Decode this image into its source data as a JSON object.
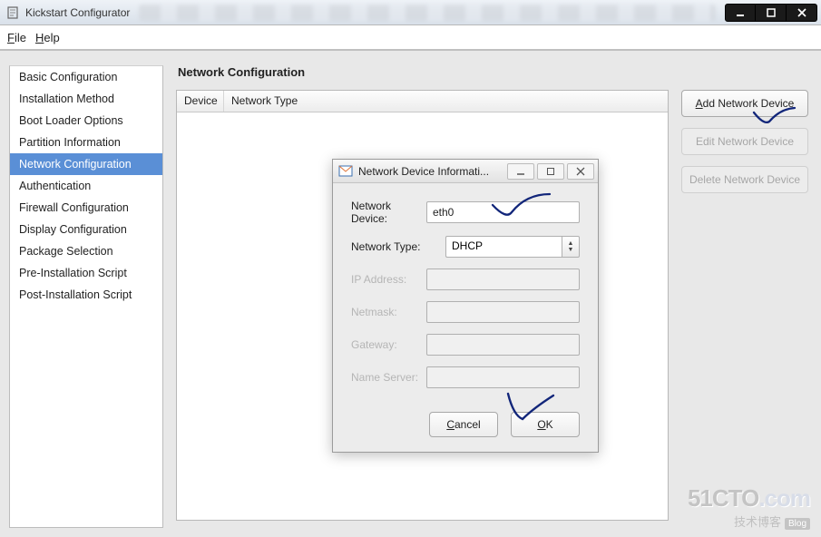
{
  "window": {
    "title": "Kickstart Configurator"
  },
  "menu": {
    "file": "File",
    "help": "Help"
  },
  "sidebar": {
    "items": [
      "Basic Configuration",
      "Installation Method",
      "Boot Loader Options",
      "Partition Information",
      "Network Configuration",
      "Authentication",
      "Firewall Configuration",
      "Display Configuration",
      "Package Selection",
      "Pre-Installation Script",
      "Post-Installation Script"
    ],
    "selected_index": 4
  },
  "content": {
    "title": "Network Configuration",
    "table": {
      "col_device": "Device",
      "col_type": "Network Type"
    },
    "buttons": {
      "add": "Add Network Device",
      "edit": "Edit Network Device",
      "delete": "Delete Network Device"
    }
  },
  "dialog": {
    "title": "Network Device Informati...",
    "labels": {
      "device": "Network Device:",
      "type": "Network Type:",
      "ip": "IP Address:",
      "netmask": "Netmask:",
      "gateway": "Gateway:",
      "ns": "Name Server:"
    },
    "values": {
      "device": "eth0",
      "type": "DHCP"
    },
    "buttons": {
      "cancel": "Cancel",
      "ok": "OK"
    }
  },
  "watermark": {
    "brand": "51CTO",
    "suffix": ".com",
    "sub": "技术博客",
    "blog": "Blog"
  }
}
